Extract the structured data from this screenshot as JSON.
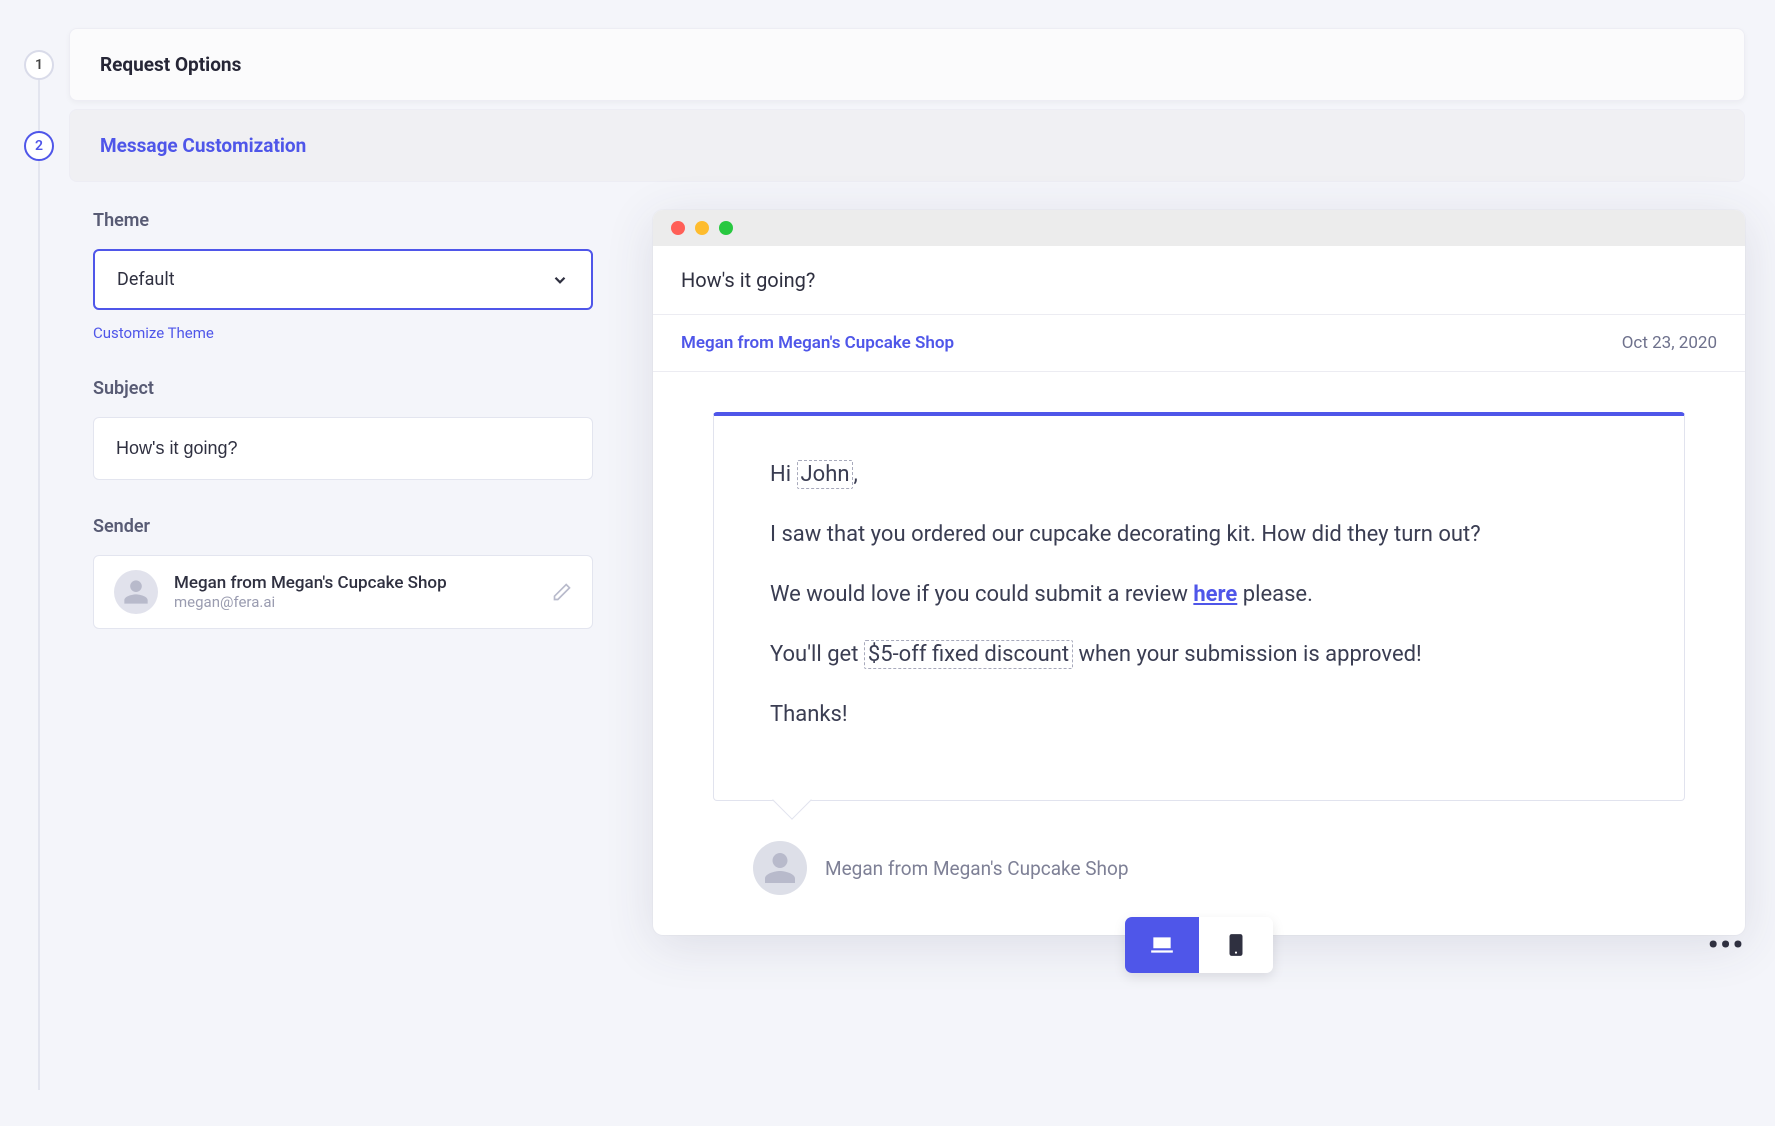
{
  "steps": [
    {
      "num": "1",
      "title": "Request Options",
      "active": false
    },
    {
      "num": "2",
      "title": "Message Customization",
      "active": true
    }
  ],
  "form": {
    "theme_label": "Theme",
    "theme_value": "Default",
    "customize_link": "Customize Theme",
    "subject_label": "Subject",
    "subject_value": "How's it going?",
    "sender_label": "Sender",
    "sender_name": "Megan from Megan's Cupcake Shop",
    "sender_email": "megan@fera.ai"
  },
  "preview": {
    "subject": "How's it going?",
    "from": "Megan from Megan's Cupcake Shop",
    "date": "Oct 23, 2020",
    "greeting_pre": "Hi ",
    "greeting_token": "John",
    "greeting_post": ",",
    "line2": "I saw that you ordered our cupcake decorating kit. How did they turn out?",
    "line3_pre": "We would love if you could submit a review ",
    "line3_link": "here",
    "line3_post": " please.",
    "line4_pre": "You'll get ",
    "line4_token": "$5-off fixed discount",
    "line4_post": " when your submission is approved!",
    "line5": "Thanks!",
    "author": "Megan from Megan's Cupcake Shop"
  }
}
